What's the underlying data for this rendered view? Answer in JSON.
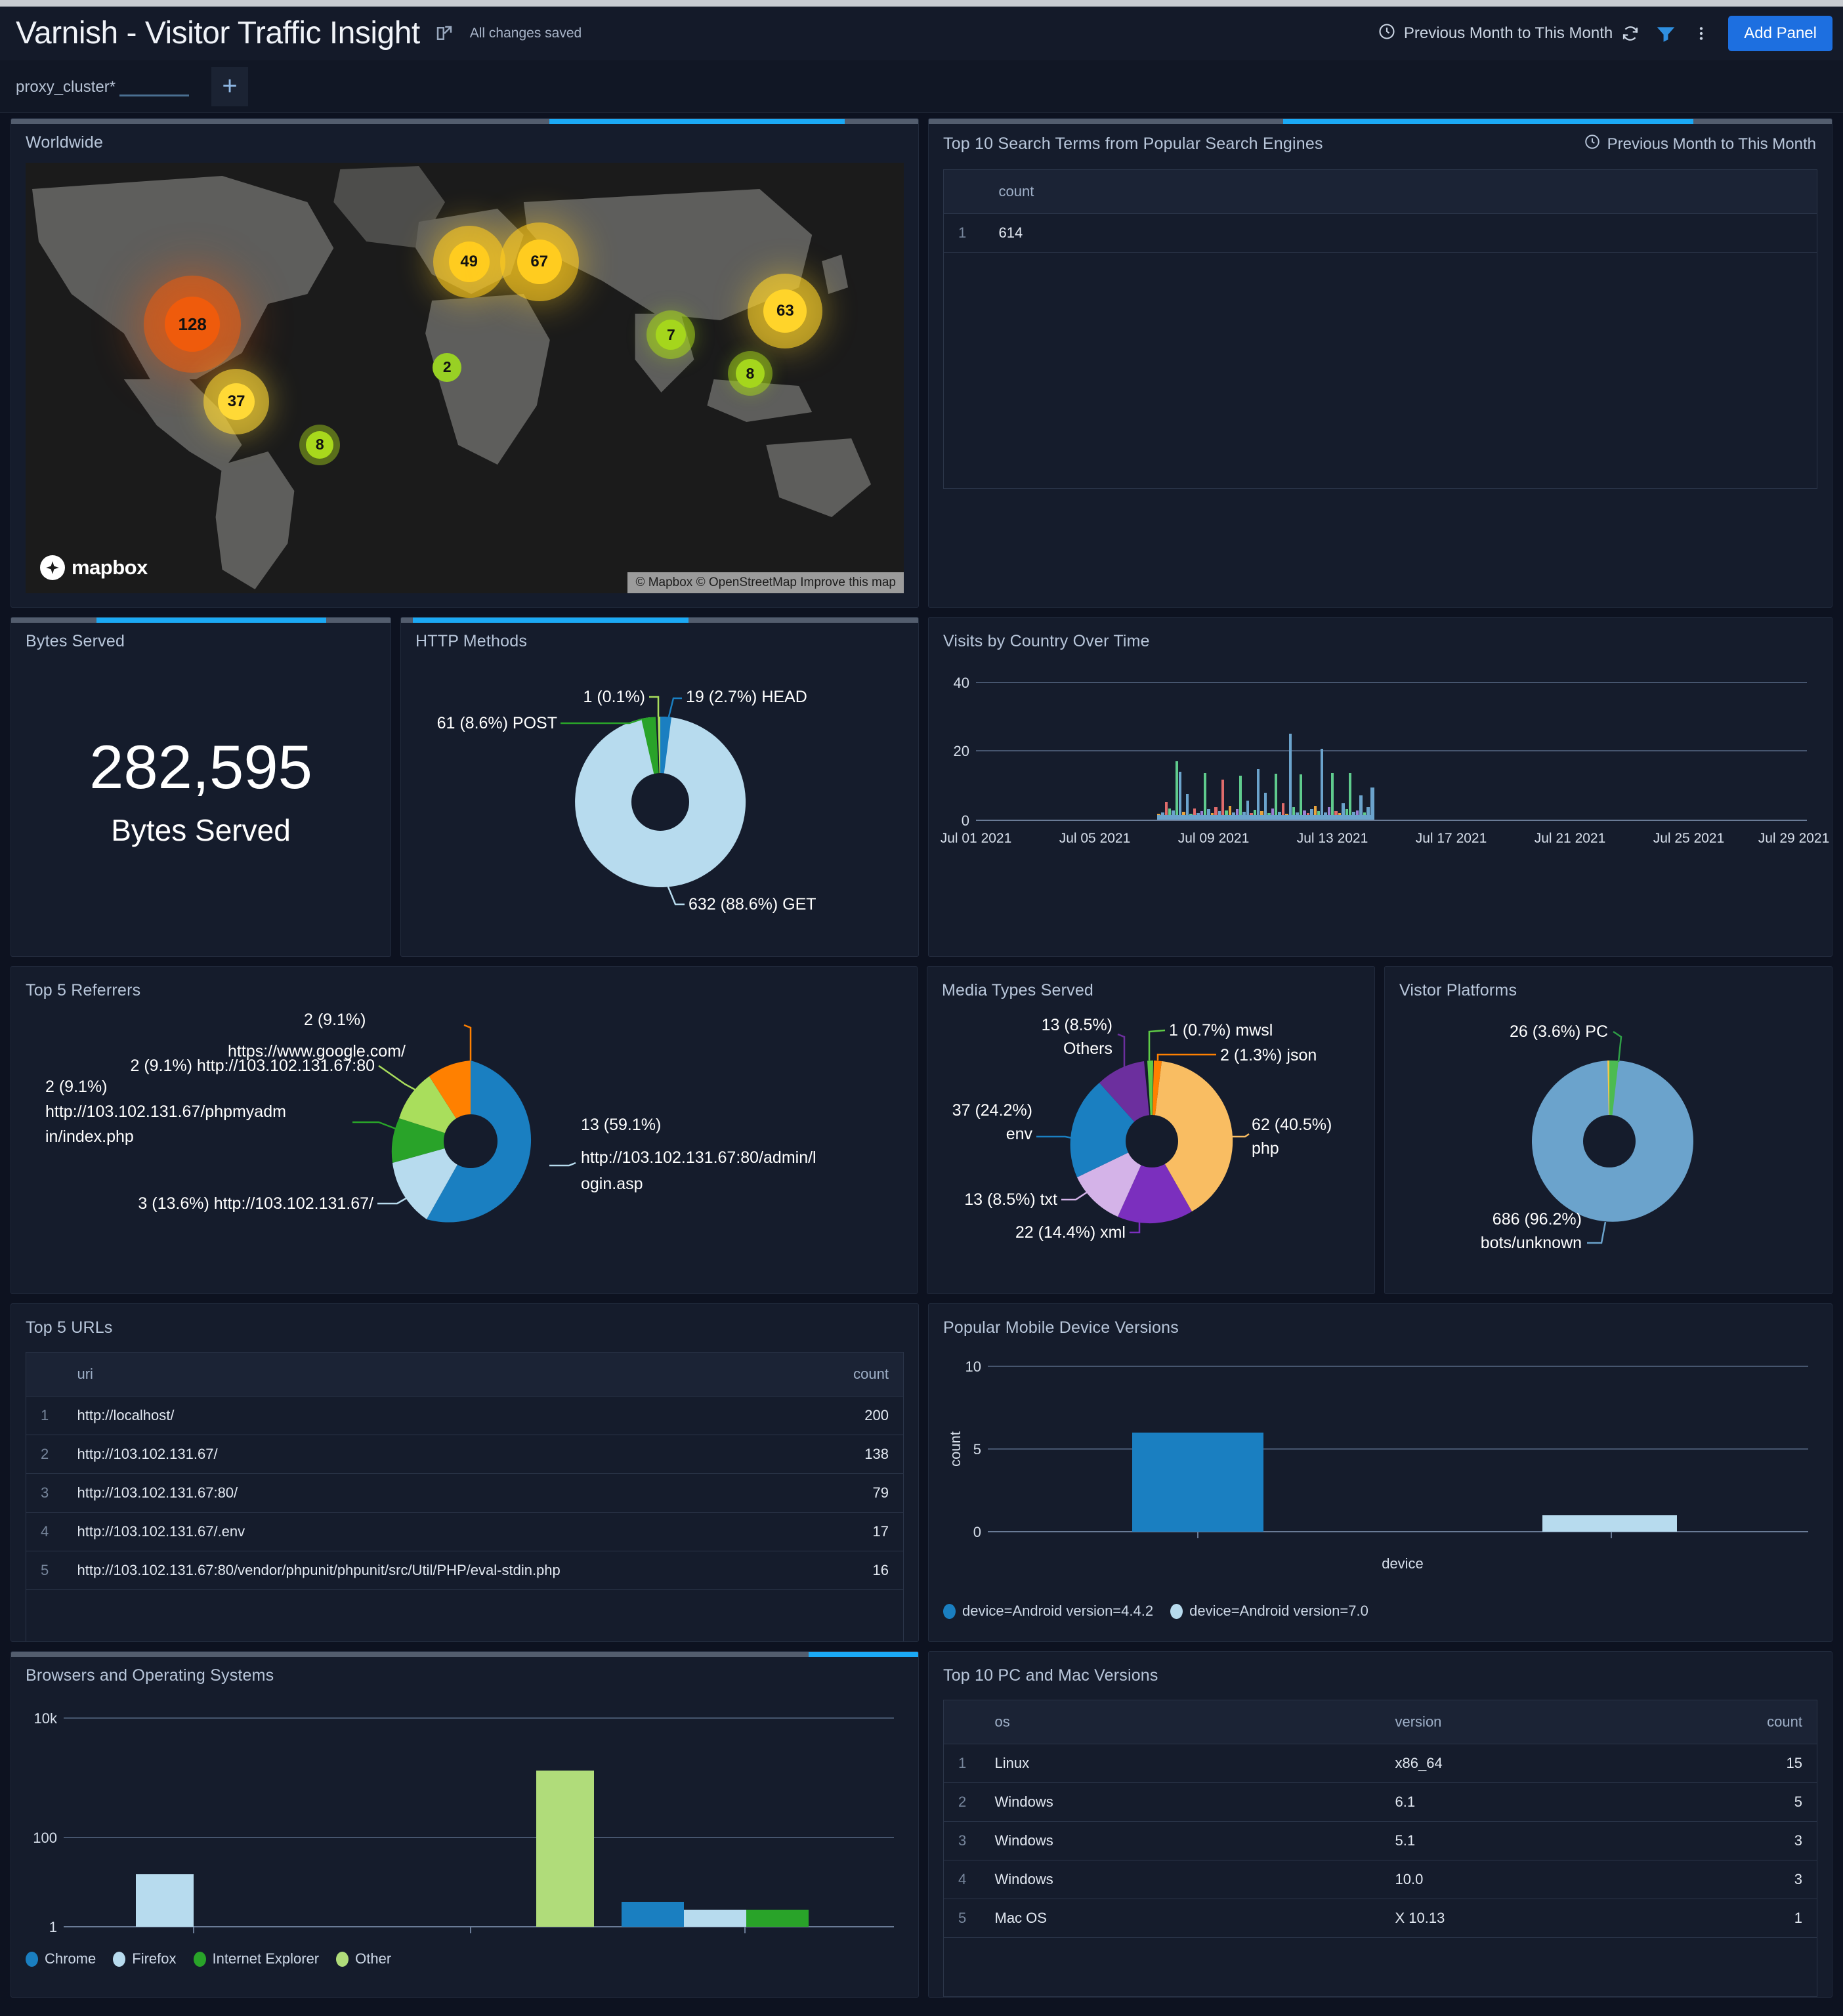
{
  "header": {
    "title": "Varnish - Visitor Traffic Insight",
    "share_icon": "share-icon",
    "saved_status": "All changes saved",
    "time_range": "Previous Month to This Month",
    "clock_icon": "clock-icon",
    "refresh_icon": "refresh-icon",
    "filter_icon": "filter-icon",
    "more_icon": "more-vertical-icon",
    "add_panel_label": "Add Panel"
  },
  "controls": {
    "proxy_cluster_label": "proxy_cluster",
    "proxy_cluster_required": "*",
    "proxy_cluster_value": "",
    "add_control_label": "+"
  },
  "panels": {
    "worldwide": {
      "title": "Worldwide",
      "mapbox_label": "mapbox",
      "attribution": "© Mapbox © OpenStreetMap Improve this map"
    },
    "search_terms": {
      "title": "Top 10 Search Terms from Popular Search Engines",
      "time_range": "Previous Month to This Month",
      "columns": [
        "count"
      ],
      "rows": [
        {
          "index": "1",
          "count": "614"
        }
      ]
    },
    "bytes_served": {
      "title": "Bytes Served",
      "value": "282,595",
      "label": "Bytes Served"
    },
    "http_methods": {
      "title": "HTTP Methods"
    },
    "visits_by_country": {
      "title": "Visits by Country Over Time"
    },
    "top_referrers": {
      "title": "Top 5 Referrers"
    },
    "media_types": {
      "title": "Media Types Served"
    },
    "visitor_platforms": {
      "title": "Vistor Platforms"
    },
    "top_urls": {
      "title": "Top 5 URLs",
      "columns": [
        "uri",
        "count"
      ],
      "rows": [
        {
          "index": "1",
          "uri": "http://localhost/",
          "count": "200"
        },
        {
          "index": "2",
          "uri": "http://103.102.131.67/",
          "count": "138"
        },
        {
          "index": "3",
          "uri": "http://103.102.131.67:80/",
          "count": "79"
        },
        {
          "index": "4",
          "uri": "http://103.102.131.67/.env",
          "count": "17"
        },
        {
          "index": "5",
          "uri": "http://103.102.131.67:80/vendor/phpunit/phpunit/src/Util/PHP/eval-stdin.php",
          "count": "16"
        }
      ]
    },
    "mobile_devices": {
      "title": "Popular Mobile Device Versions"
    },
    "browsers_os": {
      "title": "Browsers and Operating Systems"
    },
    "pc_mac_versions": {
      "title": "Top 10 PC and Mac Versions",
      "columns": [
        "os",
        "version",
        "count"
      ],
      "rows": [
        {
          "index": "1",
          "os": "Linux",
          "version": "x86_64",
          "count": "15"
        },
        {
          "index": "2",
          "os": "Windows",
          "version": "6.1",
          "count": "5"
        },
        {
          "index": "3",
          "os": "Windows",
          "version": "5.1",
          "count": "3"
        },
        {
          "index": "4",
          "os": "Windows",
          "version": "10.0",
          "count": "3"
        },
        {
          "index": "5",
          "os": "Mac OS",
          "version": "X 10.13",
          "count": "1"
        }
      ]
    }
  },
  "chart_data": [
    {
      "id": "worldwide_map",
      "type": "heatmap",
      "title": "Worldwide",
      "markers": [
        {
          "label": "128",
          "value": 128,
          "x": 19.0,
          "y": 37.5,
          "r": 42,
          "color": "#ef5b0c",
          "glow": 72
        },
        {
          "label": "49",
          "value": 49,
          "x": 50.5,
          "y": 23.0,
          "r": 31,
          "color": "#ffcc1f",
          "glow": 52
        },
        {
          "label": "67",
          "value": 67,
          "x": 58.5,
          "y": 23.0,
          "r": 34,
          "color": "#ffcc1f",
          "glow": 56
        },
        {
          "label": "63",
          "value": 63,
          "x": 86.5,
          "y": 34.5,
          "r": 33,
          "color": "#ffd42a",
          "glow": 54
        },
        {
          "label": "37",
          "value": 37,
          "x": 24.0,
          "y": 55.5,
          "r": 28,
          "color": "#ffd936",
          "glow": 46
        },
        {
          "label": "7",
          "value": 7,
          "x": 73.5,
          "y": 40.0,
          "r": 22,
          "color": "#a5d61c",
          "glow": 30
        },
        {
          "label": "2",
          "value": 2,
          "x": 48.0,
          "y": 47.5,
          "r": 20,
          "color": "#98d024",
          "glow": 0
        },
        {
          "label": "8",
          "value": 8,
          "x": 82.5,
          "y": 49.0,
          "r": 22,
          "color": "#a5d61c",
          "glow": 26
        },
        {
          "label": "8",
          "value": 8,
          "x": 33.5,
          "y": 65.5,
          "r": 21,
          "color": "#a8d81c",
          "glow": 22
        }
      ]
    },
    {
      "id": "http_methods",
      "type": "pie",
      "title": "HTTP Methods",
      "labels": [
        "GET",
        "POST",
        "HEAD",
        ""
      ],
      "values": [
        632,
        61,
        19,
        1
      ],
      "percents": [
        "88.6%",
        "8.6%",
        "2.7%",
        "0.1%"
      ],
      "colors": [
        "#b7dbee",
        "#29a329",
        "#1a7fc1",
        "#a9de5c"
      ],
      "annotations": [
        "632 (88.6%) GET",
        "61 (8.6%) POST",
        "19 (2.7%) HEAD",
        "1 (0.1%)"
      ]
    },
    {
      "id": "visits_by_country",
      "type": "bar",
      "title": "Visits by Country Over Time",
      "ylim": [
        0,
        40
      ],
      "yticks": [
        0,
        20,
        40
      ],
      "xticks": [
        "Jul 01 2021",
        "Jul 05 2021",
        "Jul 09 2021",
        "Jul 13 2021",
        "Jul 17 2021",
        "Jul 21 2021",
        "Jul 25 2021",
        "Jul 29 2021"
      ],
      "note": "dense multi-series bars between Jul 07 and Jul 14 2021, peak ~21",
      "peak": 21
    },
    {
      "id": "top_referrers",
      "type": "pie",
      "title": "Top 5 Referrers",
      "labels": [
        "http://103.102.131.67:80/admin/login.asp",
        "http://103.102.131.67/",
        "http://103.102.131.67/phpmyadmin/index.php",
        "http://103.102.131.67:80",
        "https://www.google.com/"
      ],
      "values": [
        13,
        3,
        2,
        2,
        2
      ],
      "percents": [
        "59.1%",
        "13.6%",
        "9.1%",
        "9.1%",
        "9.1%"
      ],
      "colors": [
        "#1a7fc1",
        "#b7dbee",
        "#29a329",
        "#a9de5c",
        "#ff8000"
      ],
      "annotations": [
        "13 (59.1%) http://103.102.131.67:80/admin/login.asp",
        "3 (13.6%) http://103.102.131.67/",
        "2 (9.1%) http://103.102.131.67/phpmyadmin/index.php",
        "2 (9.1%) http://103.102.131.67:80",
        "2 (9.1%) https://www.google.com/"
      ]
    },
    {
      "id": "media_types",
      "type": "pie",
      "title": "Media Types Served",
      "labels": [
        "php",
        "env",
        "xml",
        "txt",
        "Others",
        "json",
        "mwsl"
      ],
      "values": [
        62,
        37,
        22,
        13,
        13,
        2,
        1
      ],
      "percents": [
        "40.5%",
        "24.2%",
        "14.4%",
        "8.5%",
        "8.5%",
        "1.3%",
        "0.7%"
      ],
      "colors": [
        "#f9bd62",
        "#1a7fc1",
        "#7b2fbe",
        "#d4b3e8",
        "#6c2f9e",
        "#ff8000",
        "#5fcb46"
      ],
      "annotations": [
        "62 (40.5%) php",
        "37 (24.2%) env",
        "22 (14.4%) xml",
        "13 (8.5%) txt",
        "13 (8.5%) Others",
        "2 (1.3%) json",
        "1 (0.7%) mwsl"
      ]
    },
    {
      "id": "visitor_platforms",
      "type": "pie",
      "title": "Vistor Platforms",
      "labels": [
        "bots/unknown",
        "PC"
      ],
      "values": [
        686,
        26
      ],
      "percents": [
        "96.2%",
        "3.6%"
      ],
      "colors": [
        "#6ba3cc",
        "#4cbb52"
      ],
      "annotations": [
        "686 (96.2%) bots/unknown",
        "26 (3.6%) PC"
      ]
    },
    {
      "id": "mobile_devices",
      "type": "bar",
      "title": "Popular Mobile Device Versions",
      "xlabel": "device",
      "ylabel": "count",
      "ylim": [
        0,
        10
      ],
      "yticks": [
        0,
        5,
        10
      ],
      "categories": [
        "device=Android version=4.4.2",
        "device=Android version=7.0"
      ],
      "values": [
        6,
        1
      ],
      "colors": [
        "#1a7fc1",
        "#b7dbee"
      ],
      "legend": [
        "device=Android version=4.4.2",
        "device=Android version=7.0"
      ],
      "legend_position": "bottom"
    },
    {
      "id": "browsers_os",
      "type": "bar",
      "title": "Browsers and Operating Systems",
      "ylim": [
        1,
        10000
      ],
      "yscale": "log",
      "yticks": [
        "1",
        "100",
        "10k"
      ],
      "series": [
        {
          "name": "Firefox",
          "value": 9,
          "color": "#b7dbee"
        },
        {
          "name": "Other",
          "value": 330,
          "color": "#b0dc7a"
        },
        {
          "name": "Chrome",
          "value": 4,
          "color": "#1a7fc1"
        },
        {
          "name": "Firefox",
          "value": 3,
          "color": "#b7dbee"
        },
        {
          "name": "Internet Explorer",
          "value": 3,
          "color": "#29a329"
        }
      ],
      "legend": [
        "Chrome",
        "Firefox",
        "Internet Explorer",
        "Other"
      ],
      "legend_colors": [
        "#1a7fc1",
        "#b7dbee",
        "#29a329",
        "#b0dc7a"
      ],
      "legend_position": "bottom"
    }
  ]
}
